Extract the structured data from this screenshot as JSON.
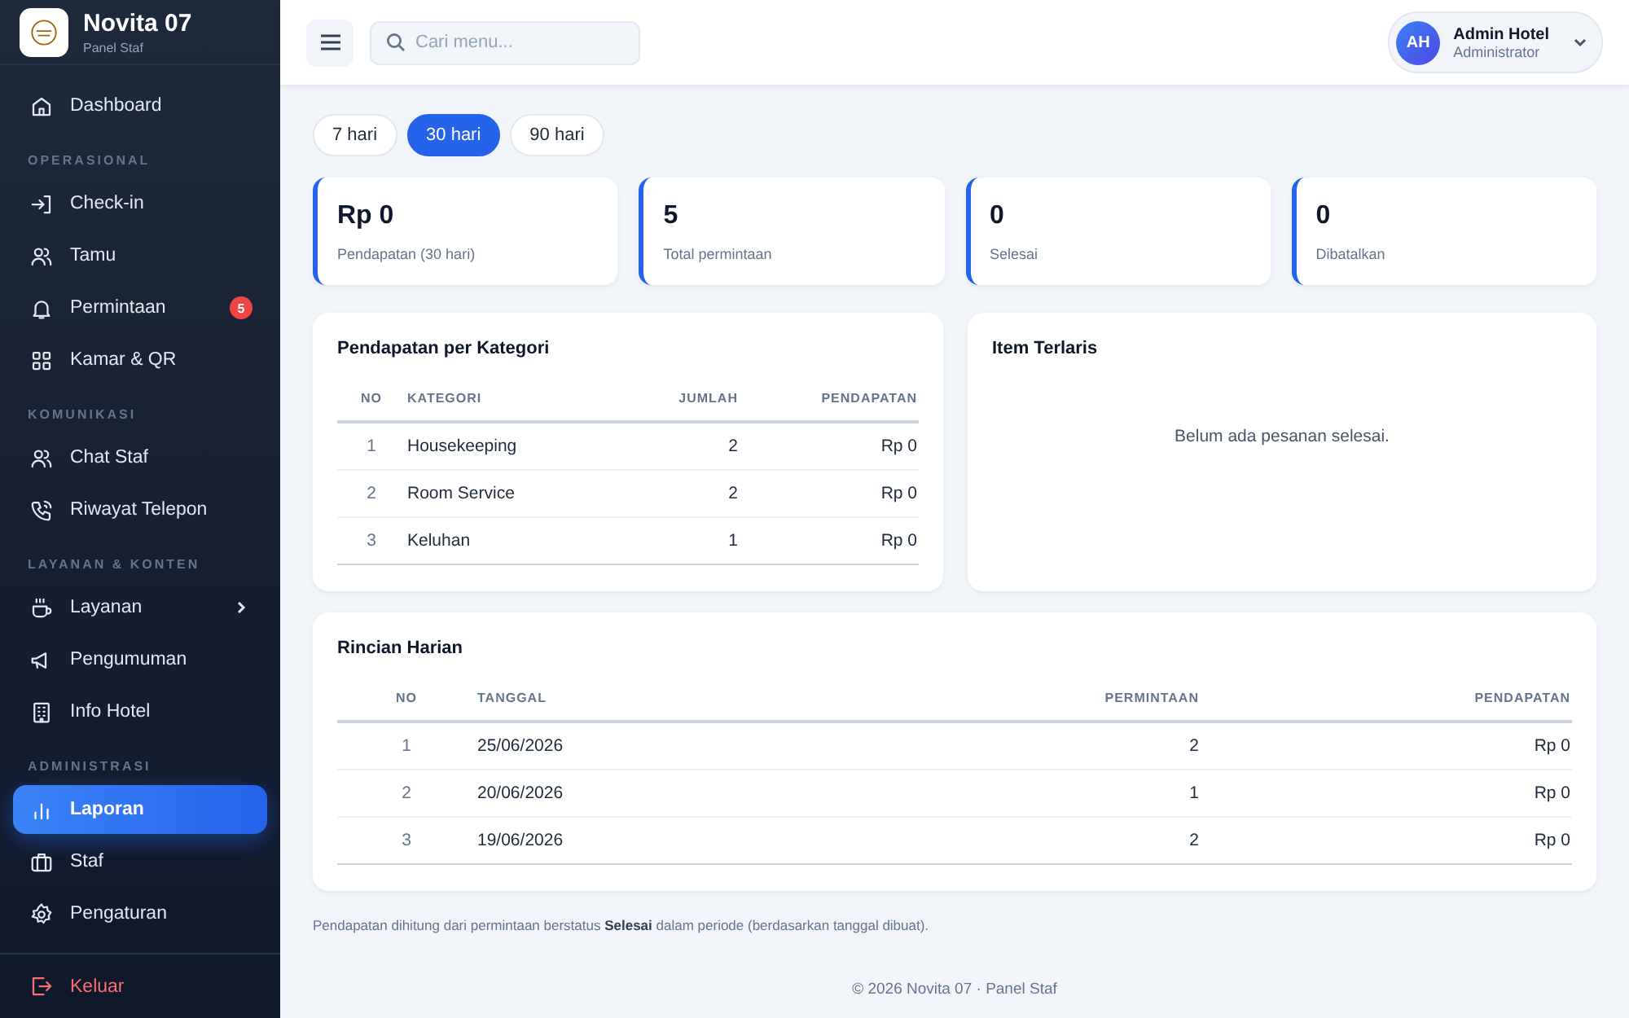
{
  "brand": {
    "title": "Novita 07",
    "subtitle": "Panel Staf"
  },
  "sidebar": {
    "sections": [
      {
        "items": [
          {
            "label": "Dashboard",
            "selected": false
          }
        ]
      },
      {
        "label": "OPERASIONAL",
        "items": [
          {
            "label": "Check-in",
            "selected": false
          },
          {
            "label": "Tamu",
            "selected": false
          },
          {
            "label": "Permintaan",
            "selected": false,
            "badge": "5"
          },
          {
            "label": "Kamar & QR",
            "selected": false
          }
        ]
      },
      {
        "label": "KOMUNIKASI",
        "items": [
          {
            "label": "Chat Staf",
            "selected": false
          },
          {
            "label": "Riwayat Telepon",
            "selected": false
          }
        ]
      },
      {
        "label": "LAYANAN & KONTEN",
        "items": [
          {
            "label": "Layanan",
            "selected": false,
            "expanded": false
          },
          {
            "label": "Pengumuman",
            "selected": false
          },
          {
            "label": "Info Hotel",
            "selected": false
          }
        ]
      },
      {
        "label": "ADMINISTRASI",
        "items": [
          {
            "label": "Laporan",
            "selected": true
          },
          {
            "label": "Staf",
            "selected": false
          },
          {
            "label": "Pengaturan",
            "selected": false
          }
        ]
      }
    ],
    "logout": "Keluar"
  },
  "header": {
    "search": {
      "placeholder": "Cari menu..."
    },
    "user": {
      "initials": "AH",
      "name": "Admin Hotel",
      "role": "Administrator"
    }
  },
  "period_tabs": [
    {
      "label": "7 hari",
      "selected": false
    },
    {
      "label": "30 hari",
      "selected": true
    },
    {
      "label": "90 hari",
      "selected": false
    }
  ],
  "stats": [
    {
      "value": "Rp 0",
      "label": "Pendapatan (30 hari)"
    },
    {
      "value": "5",
      "label": "Total permintaan"
    },
    {
      "value": "0",
      "label": "Selesai"
    },
    {
      "value": "0",
      "label": "Dibatalkan"
    }
  ],
  "category_table": {
    "title": "Pendapatan per Kategori",
    "columns": [
      "NO",
      "KATEGORI",
      "JUMLAH",
      "PENDAPATAN"
    ],
    "rows": [
      [
        "1",
        "Housekeeping",
        "2",
        "Rp 0"
      ],
      [
        "2",
        "Room Service",
        "2",
        "Rp 0"
      ],
      [
        "3",
        "Keluhan",
        "1",
        "Rp 0"
      ]
    ]
  },
  "top_items": {
    "title": "Item Terlaris",
    "empty_message": "Belum ada pesanan selesai."
  },
  "daily_table": {
    "title": "Rincian Harian",
    "columns": [
      "NO",
      "TANGGAL",
      "PERMINTAAN",
      "PENDAPATAN"
    ],
    "rows": [
      [
        "1",
        "25/06/2026",
        "2",
        "Rp 0"
      ],
      [
        "2",
        "20/06/2026",
        "1",
        "Rp 0"
      ],
      [
        "3",
        "19/06/2026",
        "2",
        "Rp 0"
      ]
    ]
  },
  "note": "Pendapatan dihitung dari permintaan berstatus **Selesai** dalam periode (berdasarkan tanggal dibuat).",
  "footer": "© 2026 Novita 07 · Panel Staf"
}
